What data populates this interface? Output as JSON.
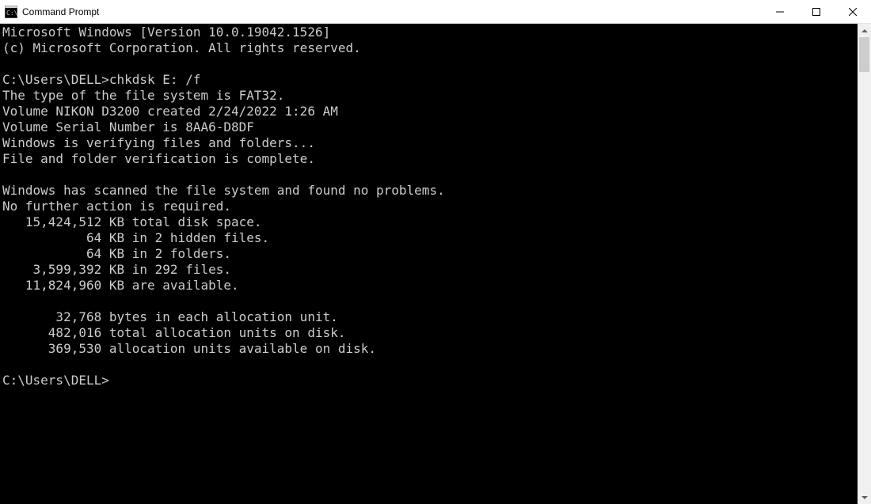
{
  "window": {
    "title": "Command Prompt"
  },
  "terminal": {
    "lines": [
      "Microsoft Windows [Version 10.0.19042.1526]",
      "(c) Microsoft Corporation. All rights reserved.",
      "",
      "C:\\Users\\DELL>chkdsk E: /f",
      "The type of the file system is FAT32.",
      "Volume NIKON D3200 created 2/24/2022 1:26 AM",
      "Volume Serial Number is 8AA6-D8DF",
      "Windows is verifying files and folders...",
      "File and folder verification is complete.",
      "",
      "Windows has scanned the file system and found no problems.",
      "No further action is required.",
      "   15,424,512 KB total disk space.",
      "           64 KB in 2 hidden files.",
      "           64 KB in 2 folders.",
      "    3,599,392 KB in 292 files.",
      "   11,824,960 KB are available.",
      "",
      "       32,768 bytes in each allocation unit.",
      "      482,016 total allocation units on disk.",
      "      369,530 allocation units available on disk.",
      "",
      "C:\\Users\\DELL>"
    ]
  }
}
